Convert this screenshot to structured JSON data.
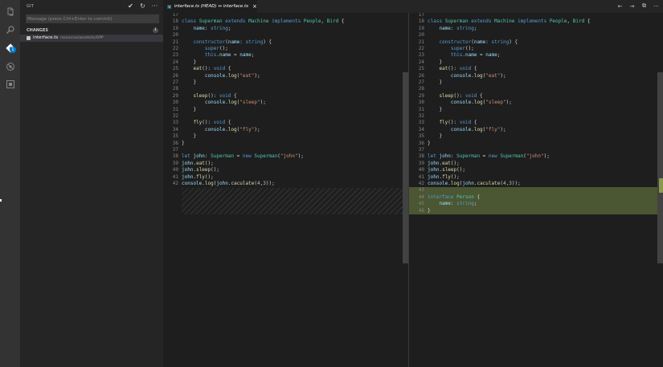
{
  "sidebar": {
    "title": "GIT",
    "message_placeholder": "Message (press Ctrl+Enter to commit)",
    "changes_label": "CHANGES",
    "changes_count": "1",
    "file": {
      "icon": "ts-file-icon",
      "name": "interface.ts",
      "path": "resources/assets/ts/OPP"
    }
  },
  "activity": {
    "git_badge": "1"
  },
  "tab": {
    "label": "interface.ts (HEAD) ↔ interface.ts",
    "icon": "ts"
  },
  "colors": {
    "accent": "#007acc",
    "added_line": "#4b5632"
  },
  "left_lines": [
    {
      "n": "17",
      "t": ""
    },
    {
      "n": "18",
      "t": "class Superman extends Machine implements People, Bird {"
    },
    {
      "n": "19",
      "t": "    name: string;"
    },
    {
      "n": "20",
      "t": ""
    },
    {
      "n": "21",
      "t": "    constructor(name: string) {"
    },
    {
      "n": "22",
      "t": "        super();"
    },
    {
      "n": "23",
      "t": "        this.name = name;"
    },
    {
      "n": "24",
      "t": "    }"
    },
    {
      "n": "25",
      "t": "    eat(): void {"
    },
    {
      "n": "26",
      "t": "        console.log(\"eat\");"
    },
    {
      "n": "27",
      "t": "    }"
    },
    {
      "n": "28",
      "t": ""
    },
    {
      "n": "29",
      "t": "    sleep(): void {"
    },
    {
      "n": "30",
      "t": "        console.log(\"sleep\");"
    },
    {
      "n": "31",
      "t": "    }"
    },
    {
      "n": "32",
      "t": ""
    },
    {
      "n": "33",
      "t": "    fly(): void {"
    },
    {
      "n": "34",
      "t": "        console.log(\"fly\");"
    },
    {
      "n": "35",
      "t": "    }"
    },
    {
      "n": "36",
      "t": "}"
    },
    {
      "n": "37",
      "t": ""
    },
    {
      "n": "38",
      "t": "let john: Superman = new Superman(\"john\");"
    },
    {
      "n": "39",
      "t": "john.eat();"
    },
    {
      "n": "40",
      "t": "john.sleep();"
    },
    {
      "n": "41",
      "t": "john.fly();"
    },
    {
      "n": "42",
      "t": "console.log(john.caculate(4,3));"
    }
  ],
  "right_lines": [
    {
      "n": "17",
      "t": ""
    },
    {
      "n": "18",
      "t": "class Superman extends Machine implements People, Bird {"
    },
    {
      "n": "19",
      "t": "    name: string;"
    },
    {
      "n": "20",
      "t": ""
    },
    {
      "n": "21",
      "t": "    constructor(name: string) {"
    },
    {
      "n": "22",
      "t": "        super();"
    },
    {
      "n": "23",
      "t": "        this.name = name;"
    },
    {
      "n": "24",
      "t": "    }"
    },
    {
      "n": "25",
      "t": "    eat(): void {"
    },
    {
      "n": "26",
      "t": "        console.log(\"eat\");"
    },
    {
      "n": "27",
      "t": "    }"
    },
    {
      "n": "28",
      "t": ""
    },
    {
      "n": "29",
      "t": "    sleep(): void {"
    },
    {
      "n": "30",
      "t": "        console.log(\"sleep\");"
    },
    {
      "n": "31",
      "t": "    }"
    },
    {
      "n": "32",
      "t": ""
    },
    {
      "n": "33",
      "t": "    fly(): void {"
    },
    {
      "n": "34",
      "t": "        console.log(\"fly\");"
    },
    {
      "n": "35",
      "t": "    }"
    },
    {
      "n": "36",
      "t": "}"
    },
    {
      "n": "37",
      "t": ""
    },
    {
      "n": "38",
      "t": "let john: Superman = new Superman(\"john\");"
    },
    {
      "n": "39",
      "t": "john.eat();"
    },
    {
      "n": "40",
      "t": "john.sleep();"
    },
    {
      "n": "41",
      "t": "john.fly();"
    },
    {
      "n": "42",
      "t": "console.log(john.caculate(4,3));"
    },
    {
      "n": "43",
      "t": "",
      "added": true
    },
    {
      "n": "44",
      "t": "interface Person {",
      "added": true
    },
    {
      "n": "45",
      "t": "    name: string;",
      "added": true
    },
    {
      "n": "46",
      "t": "}",
      "added": true
    }
  ]
}
